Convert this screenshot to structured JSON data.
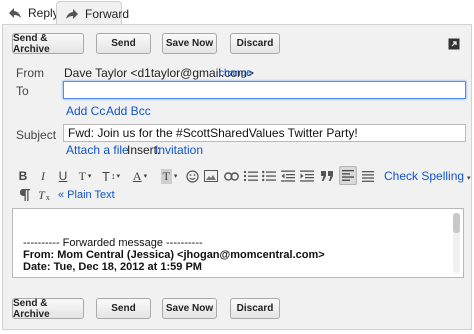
{
  "tabs": {
    "reply": "Reply",
    "forward": "Forward"
  },
  "buttons": {
    "send_archive": "Send & Archive",
    "send": "Send",
    "save_now": "Save Now",
    "discard": "Discard"
  },
  "from": {
    "label": "From",
    "value": "Dave Taylor <d1taylor@gmail.com>",
    "change": "change"
  },
  "to": {
    "label": "To",
    "value": ""
  },
  "add_cc": "Add Cc",
  "add_bcc": "Add Bcc",
  "subject": {
    "label": "Subject",
    "value": "Fwd: Join us for the #ScottSharedValues Twitter Party!"
  },
  "attach": "Attach a file",
  "insert": {
    "label": "Insert:",
    "invitation": "Invitation"
  },
  "toolbar": {
    "bold": "B",
    "italic": "I",
    "underline": "U",
    "font": "T",
    "size": "T",
    "text_color": "A",
    "bg_color": "T",
    "check_spelling": "Check Spelling",
    "plain_text": "« Plain Text",
    "remove_format": "T"
  },
  "body": {
    "forwarded_header": "---------- Forwarded message ----------",
    "from_label": "From:",
    "from_value": "Mom Central (Jessica) <jhogan@momcentral.com>",
    "date_label": "Date:",
    "date_value": "Tue, Dec 18, 2012 at 1:59 PM"
  }
}
